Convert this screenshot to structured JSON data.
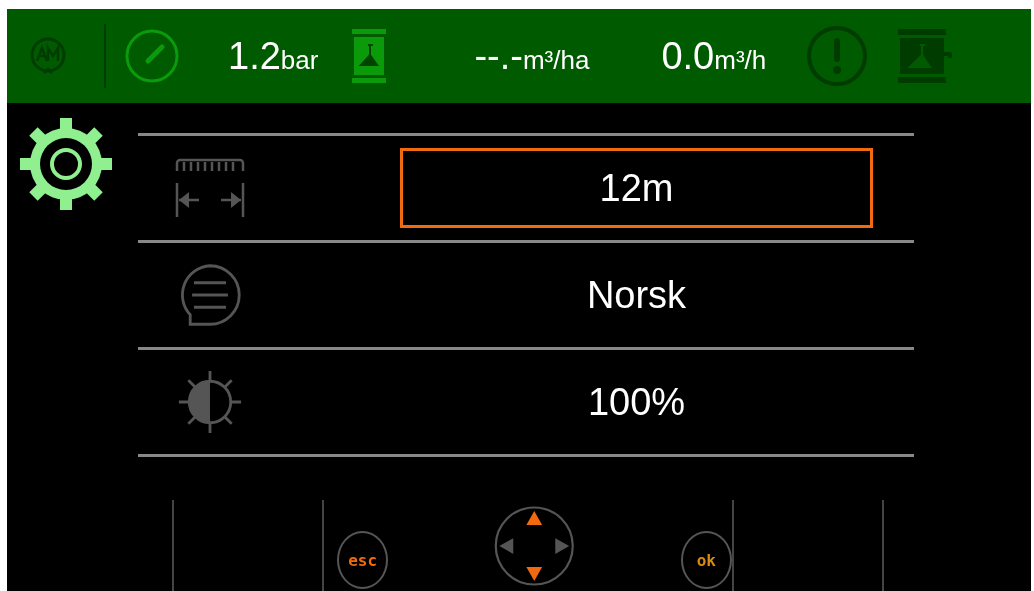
{
  "status_bar": {
    "readings": [
      {
        "value": "1.2",
        "unit": "bar"
      },
      {
        "value": "--.-",
        "unit": "m³/ha"
      },
      {
        "value": "0.0",
        "unit": "m³/h"
      }
    ]
  },
  "settings": [
    {
      "kind": "width",
      "value": "12m",
      "selected": true
    },
    {
      "kind": "language",
      "value": "Norsk",
      "selected": false
    },
    {
      "kind": "brightness",
      "value": "100%",
      "selected": false
    }
  ],
  "buttons": {
    "esc": "esc",
    "ok": "ok"
  },
  "dpad": {
    "up": {
      "enabled": true
    },
    "down": {
      "enabled": true
    },
    "left": {
      "enabled": false
    },
    "right": {
      "enabled": false
    }
  }
}
